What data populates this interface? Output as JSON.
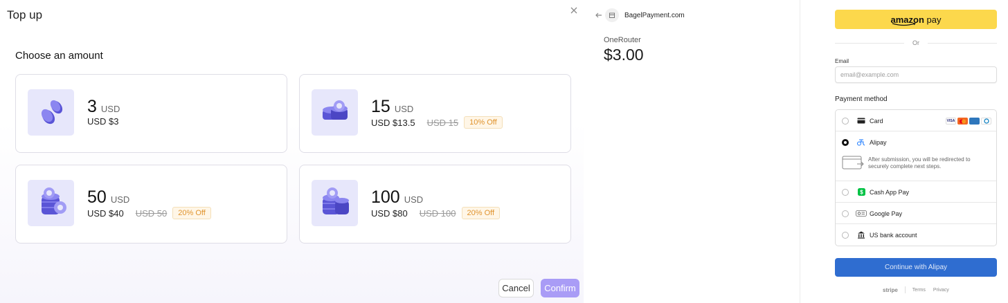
{
  "topup": {
    "title": "Top up",
    "section_title": "Choose an amount",
    "cards": [
      {
        "amount": "3",
        "unit": "USD",
        "price": "USD $3",
        "original": "",
        "discount": ""
      },
      {
        "amount": "15",
        "unit": "USD",
        "price": "USD $13.5",
        "original": "USD 15",
        "discount": "10% Off"
      },
      {
        "amount": "50",
        "unit": "USD",
        "price": "USD $40",
        "original": "USD 50",
        "discount": "20% Off"
      },
      {
        "amount": "100",
        "unit": "USD",
        "price": "USD $80",
        "original": "USD 100",
        "discount": "20% Off"
      }
    ],
    "cancel_label": "Cancel",
    "confirm_label": "Confirm"
  },
  "summary": {
    "merchant": "BagelPayment.com",
    "product": "OneRouter",
    "total": "$3.00"
  },
  "payment": {
    "amazon_label_a": "amazon",
    "amazon_label_b": " pay",
    "or_label": "Or",
    "email_label": "Email",
    "email_placeholder": "email@example.com",
    "method_label": "Payment method",
    "methods": [
      {
        "name": "Card",
        "selected": false,
        "icon": "card-icon"
      },
      {
        "name": "Alipay",
        "selected": true,
        "icon": "alipay-icon"
      },
      {
        "name": "Cash App Pay",
        "selected": false,
        "icon": "cash-app-icon"
      },
      {
        "name": "Google Pay",
        "selected": false,
        "icon": "google-pay-icon"
      },
      {
        "name": "US bank account",
        "selected": false,
        "icon": "bank-icon"
      }
    ],
    "card_brands": [
      "VISA",
      "MC",
      "AMEX",
      "DC"
    ],
    "alipay_note": "After submission, you will be redirected to securely complete next steps.",
    "continue_label": "Continue with Alipay",
    "footer": {
      "brand": "stripe",
      "terms": "Terms",
      "privacy": "Privacy"
    }
  },
  "colors": {
    "accent": "#a99cf6",
    "amazon": "#fcd84c",
    "continue": "#2f6dd0",
    "discount_text": "#e0932d"
  }
}
